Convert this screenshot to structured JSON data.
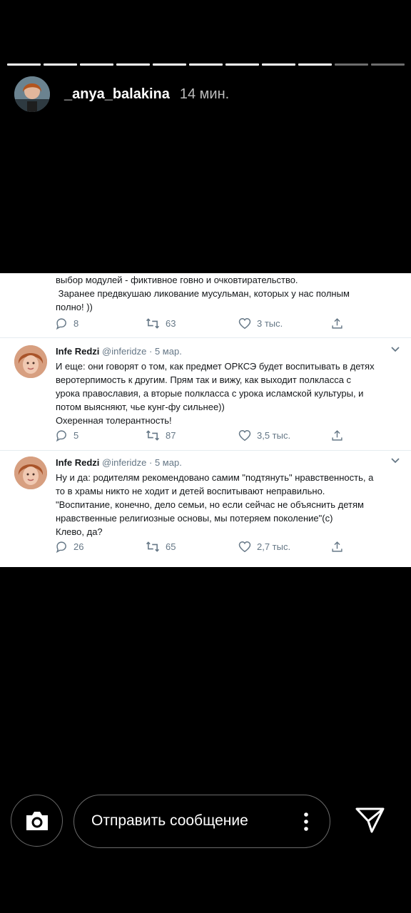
{
  "story": {
    "username": "_anya_balakina",
    "time": "14 мин."
  },
  "tweets": {
    "continued": {
      "lines": [
        "выбор модулей - фиктивное говно и очковтирательство.",
        " Заранее предвкушаю ликование мусульман, которых у нас полным",
        "полно! ))"
      ],
      "replies": "8",
      "retweets": "63",
      "likes": "3 тыс."
    },
    "t1": {
      "name": "Infe Redzi",
      "handle": "@inferidze",
      "sep": "·",
      "date": "5 мар.",
      "lines": [
        "И еще: они говорят о том, как предмет ОРКСЭ будет воспитывать в детях",
        "веротерпимость к другим. Прям так и вижу, как выходит полкласса с",
        "урока православия, а вторые полкласса с урока исламской культуры, и",
        "потом выясняют, чье кунг-фу сильнее))",
        "Охеренная толерантность!"
      ],
      "replies": "5",
      "retweets": "87",
      "likes": "3,5 тыс."
    },
    "t2": {
      "name": "Infe Redzi",
      "handle": "@inferidze",
      "sep": "·",
      "date": "5 мар.",
      "lines": [
        "Ну и да: родителям рекомендовано самим \"подтянуть\" нравственность, а",
        "то в храмы никто не ходит и детей воспитывают неправильно.",
        "\"Воспитание, конечно, дело семьи, но если сейчас не объяснить детям",
        "нравственные религиозные основы, мы потеряем поколение\"(с)",
        "Клево, да?"
      ],
      "replies": "26",
      "retweets": "65",
      "likes": "2,7 тыс."
    }
  },
  "composer": {
    "placeholder": "Отправить сообщение"
  },
  "icons": [
    "camera-icon",
    "more-vertical-icon",
    "send-icon",
    "reply-icon",
    "retweet-icon",
    "like-icon",
    "share-icon",
    "chevron-down-icon"
  ],
  "colors": {
    "background": "#000000",
    "card": "#ffffff",
    "muted": "#657786",
    "text": "#14171a"
  }
}
